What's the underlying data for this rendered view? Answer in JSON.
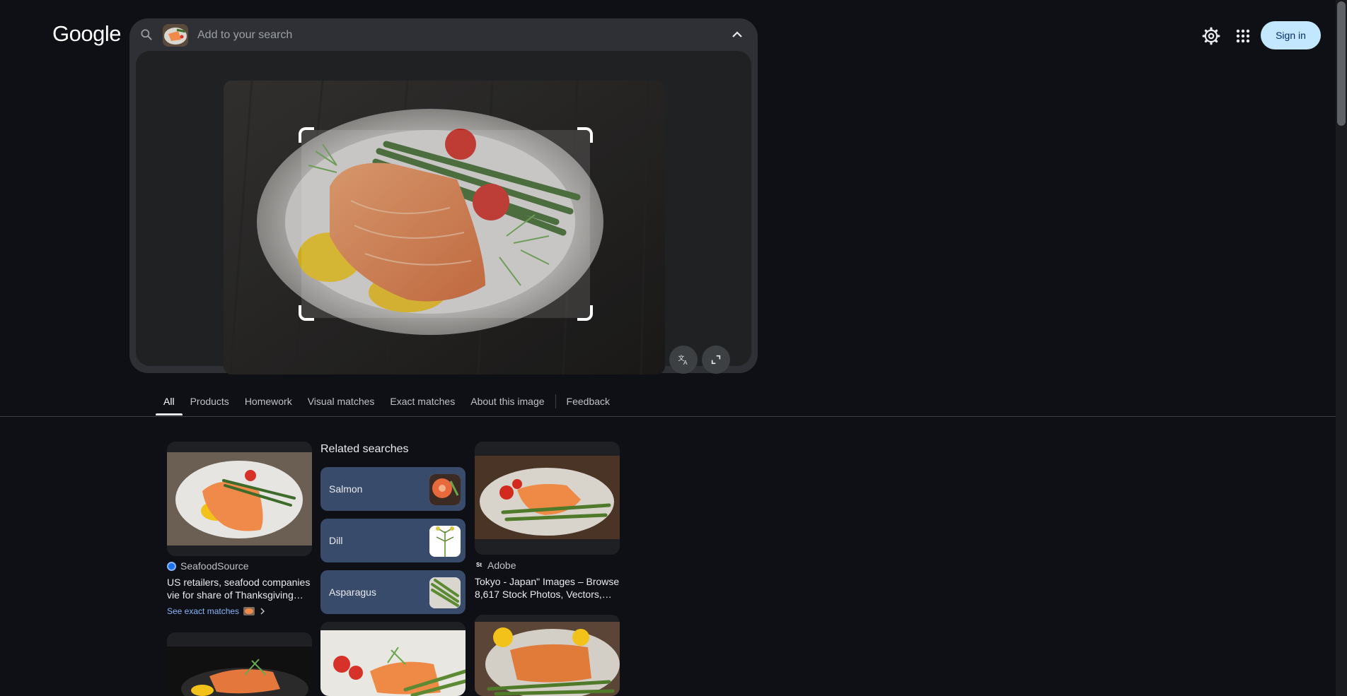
{
  "header": {
    "logo_text": "Google",
    "sign_in_label": "Sign in",
    "settings_icon": "gear-icon",
    "apps_icon": "apps-grid-icon"
  },
  "search": {
    "placeholder": "Add to your search",
    "search_icon": "search-icon",
    "collapse_icon": "chevron-up-icon"
  },
  "image_panel": {
    "translate_icon": "translate-icon",
    "expand_icon": "expand-icon"
  },
  "tabs": [
    {
      "label": "All",
      "active": true
    },
    {
      "label": "Products",
      "active": false
    },
    {
      "label": "Homework",
      "active": false
    },
    {
      "label": "Visual matches",
      "active": false
    },
    {
      "label": "Exact matches",
      "active": false
    },
    {
      "label": "About this image",
      "active": false
    },
    {
      "label": "Feedback",
      "active": false
    }
  ],
  "results": {
    "card1": {
      "source": "SeafoodSource",
      "title": "US retailers, seafood companies vie for share of Thanksgiving…",
      "exact_matches_label": "See exact matches"
    },
    "related": {
      "title": "Related searches",
      "items": [
        {
          "label": "Salmon"
        },
        {
          "label": "Dill"
        },
        {
          "label": "Asparagus"
        }
      ]
    },
    "card3": {
      "source": "Adobe",
      "title": "Tokyo - Japan\" Images – Browse 8,617 Stock Photos, Vectors,…"
    }
  },
  "colors": {
    "background": "#0e1016",
    "search_bg": "#2f3036",
    "sign_in_bg": "#c2e7ff",
    "chip_bg": "#394b6b",
    "link": "#8ab4f8"
  }
}
